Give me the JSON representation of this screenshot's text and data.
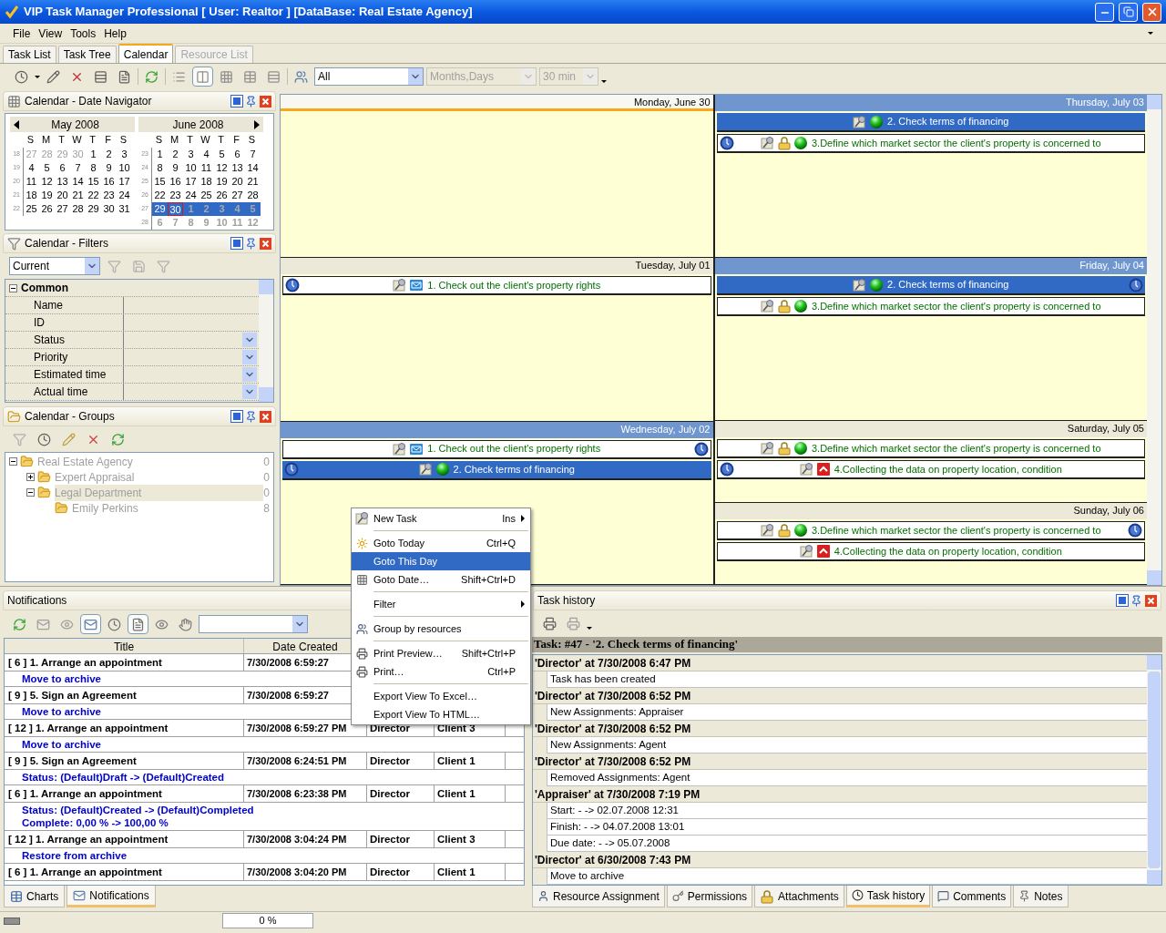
{
  "window": {
    "title": "VIP Task Manager Professional [ User: Realtor ] [DataBase: Real Estate Agency]"
  },
  "menu": [
    "File",
    "View",
    "Tools",
    "Help"
  ],
  "tabs": [
    {
      "label": "Task List",
      "selected": false,
      "disabled": false
    },
    {
      "label": "Task Tree",
      "selected": false,
      "disabled": false
    },
    {
      "label": "Calendar",
      "selected": true,
      "disabled": false
    },
    {
      "label": "Resource List",
      "selected": false,
      "disabled": true
    }
  ],
  "toolbar": {
    "views": [
      {
        "selected": false
      },
      {
        "selected": true
      },
      {
        "selected": false
      },
      {
        "selected": false
      },
      {
        "selected": false
      }
    ],
    "combos": [
      {
        "value": "All",
        "disabled": false
      },
      {
        "value": "Months,Days",
        "disabled": true
      },
      {
        "value": "30 min",
        "disabled": true
      }
    ]
  },
  "date_navigator": {
    "title": "Calendar - Date Navigator",
    "months": [
      {
        "title": "May 2008",
        "weekdays": [
          "S",
          "M",
          "T",
          "W",
          "T",
          "F",
          "S"
        ],
        "weeks": [
          {
            "number": "18",
            "days": [
              {
                "label": "27",
                "other": true,
                "selected": false,
                "today": false
              },
              {
                "label": "28",
                "other": true,
                "selected": false,
                "today": false
              },
              {
                "label": "29",
                "other": true,
                "selected": false,
                "today": false
              },
              {
                "label": "30",
                "other": true,
                "selected": false,
                "today": false
              },
              {
                "label": "1",
                "other": false,
                "selected": false,
                "today": false
              },
              {
                "label": "2",
                "other": false,
                "selected": false,
                "today": false
              },
              {
                "label": "3",
                "other": false,
                "selected": false,
                "today": false
              }
            ]
          },
          {
            "number": "19",
            "days": [
              {
                "label": "4",
                "other": false,
                "selected": false,
                "today": false
              },
              {
                "label": "5",
                "other": false,
                "selected": false,
                "today": false
              },
              {
                "label": "6",
                "other": false,
                "selected": false,
                "today": false
              },
              {
                "label": "7",
                "other": false,
                "selected": false,
                "today": false
              },
              {
                "label": "8",
                "other": false,
                "selected": false,
                "today": false
              },
              {
                "label": "9",
                "other": false,
                "selected": false,
                "today": false
              },
              {
                "label": "10",
                "other": false,
                "selected": false,
                "today": false
              }
            ]
          },
          {
            "number": "20",
            "days": [
              {
                "label": "11",
                "other": false,
                "selected": false,
                "today": false
              },
              {
                "label": "12",
                "other": false,
                "selected": false,
                "today": false
              },
              {
                "label": "13",
                "other": false,
                "selected": false,
                "today": false
              },
              {
                "label": "14",
                "other": false,
                "selected": false,
                "today": false
              },
              {
                "label": "15",
                "other": false,
                "selected": false,
                "today": false
              },
              {
                "label": "16",
                "other": false,
                "selected": false,
                "today": false
              },
              {
                "label": "17",
                "other": false,
                "selected": false,
                "today": false
              }
            ]
          },
          {
            "number": "21",
            "days": [
              {
                "label": "18",
                "other": false,
                "selected": false,
                "today": false
              },
              {
                "label": "19",
                "other": false,
                "selected": false,
                "today": false
              },
              {
                "label": "20",
                "other": false,
                "selected": false,
                "today": false
              },
              {
                "label": "21",
                "other": false,
                "selected": false,
                "today": false
              },
              {
                "label": "22",
                "other": false,
                "selected": false,
                "today": false
              },
              {
                "label": "23",
                "other": false,
                "selected": false,
                "today": false
              },
              {
                "label": "24",
                "other": false,
                "selected": false,
                "today": false
              }
            ]
          },
          {
            "number": "22",
            "days": [
              {
                "label": "25",
                "other": false,
                "selected": false,
                "today": false
              },
              {
                "label": "26",
                "other": false,
                "selected": false,
                "today": false
              },
              {
                "label": "27",
                "other": false,
                "selected": false,
                "today": false
              },
              {
                "label": "28",
                "other": false,
                "selected": false,
                "today": false
              },
              {
                "label": "29",
                "other": false,
                "selected": false,
                "today": false
              },
              {
                "label": "30",
                "other": false,
                "selected": false,
                "today": false
              },
              {
                "label": "31",
                "other": false,
                "selected": false,
                "today": false
              }
            ]
          }
        ]
      },
      {
        "title": "June 2008",
        "weekdays": [
          "S",
          "M",
          "T",
          "W",
          "T",
          "F",
          "S"
        ],
        "weeks": [
          {
            "number": "23",
            "days": [
              {
                "label": "1",
                "other": false,
                "selected": false,
                "today": false
              },
              {
                "label": "2",
                "other": false,
                "selected": false,
                "today": false
              },
              {
                "label": "3",
                "other": false,
                "selected": false,
                "today": false
              },
              {
                "label": "4",
                "other": false,
                "selected": false,
                "today": false
              },
              {
                "label": "5",
                "other": false,
                "selected": false,
                "today": false
              },
              {
                "label": "6",
                "other": false,
                "selected": false,
                "today": false
              },
              {
                "label": "7",
                "other": false,
                "selected": false,
                "today": false
              }
            ]
          },
          {
            "number": "24",
            "days": [
              {
                "label": "8",
                "other": false,
                "selected": false,
                "today": false
              },
              {
                "label": "9",
                "other": false,
                "selected": false,
                "today": false
              },
              {
                "label": "10",
                "other": false,
                "selected": false,
                "today": false
              },
              {
                "label": "11",
                "other": false,
                "selected": false,
                "today": false
              },
              {
                "label": "12",
                "other": false,
                "selected": false,
                "today": false
              },
              {
                "label": "13",
                "other": false,
                "selected": false,
                "today": false
              },
              {
                "label": "14",
                "other": false,
                "selected": false,
                "today": false
              }
            ]
          },
          {
            "number": "25",
            "days": [
              {
                "label": "15",
                "other": false,
                "selected": false,
                "today": false
              },
              {
                "label": "16",
                "other": false,
                "selected": false,
                "today": false
              },
              {
                "label": "17",
                "other": false,
                "selected": false,
                "today": false
              },
              {
                "label": "18",
                "other": false,
                "selected": false,
                "today": false
              },
              {
                "label": "19",
                "other": false,
                "selected": false,
                "today": false
              },
              {
                "label": "20",
                "other": false,
                "selected": false,
                "today": false
              },
              {
                "label": "21",
                "other": false,
                "selected": false,
                "today": false
              }
            ]
          },
          {
            "number": "26",
            "days": [
              {
                "label": "22",
                "other": false,
                "selected": false,
                "today": false
              },
              {
                "label": "23",
                "other": false,
                "selected": false,
                "today": false
              },
              {
                "label": "24",
                "other": false,
                "selected": false,
                "today": false
              },
              {
                "label": "25",
                "other": false,
                "selected": false,
                "today": false
              },
              {
                "label": "26",
                "other": false,
                "selected": false,
                "today": false
              },
              {
                "label": "27",
                "other": false,
                "selected": false,
                "today": false
              },
              {
                "label": "28",
                "other": false,
                "selected": false,
                "today": false
              }
            ]
          },
          {
            "number": "27",
            "days": [
              {
                "label": "29",
                "other": false,
                "selected": true,
                "today": false
              },
              {
                "label": "30",
                "other": false,
                "selected": true,
                "today": true
              },
              {
                "label": "1",
                "other": true,
                "selected": true,
                "today": false
              },
              {
                "label": "2",
                "other": true,
                "selected": true,
                "today": false
              },
              {
                "label": "3",
                "other": true,
                "selected": true,
                "today": false
              },
              {
                "label": "4",
                "other": true,
                "selected": true,
                "today": false
              },
              {
                "label": "5",
                "other": true,
                "selected": true,
                "today": false
              }
            ]
          },
          {
            "number": "28",
            "days": [
              {
                "label": "6",
                "other": true,
                "selected": false,
                "today": false
              },
              {
                "label": "7",
                "other": true,
                "selected": false,
                "today": false
              },
              {
                "label": "8",
                "other": true,
                "selected": false,
                "today": false
              },
              {
                "label": "9",
                "other": true,
                "selected": false,
                "today": false
              },
              {
                "label": "10",
                "other": true,
                "selected": false,
                "today": false
              },
              {
                "label": "11",
                "other": true,
                "selected": false,
                "today": false
              },
              {
                "label": "12",
                "other": true,
                "selected": false,
                "today": false
              }
            ]
          }
        ]
      }
    ]
  },
  "filters": {
    "title": "Calendar - Filters",
    "combo": "Current",
    "category": {
      "label": "Common",
      "expanded": true
    },
    "rows": [
      {
        "label": "Name",
        "kind": "text"
      },
      {
        "label": "ID",
        "kind": "text"
      },
      {
        "label": "Status",
        "kind": "dropdown"
      },
      {
        "label": "Priority",
        "kind": "dropdown"
      },
      {
        "label": "Estimated time",
        "kind": "dropdown"
      },
      {
        "label": "Actual time",
        "kind": "dropdown"
      }
    ]
  },
  "groups": {
    "title": "Calendar - Groups",
    "tree": [
      {
        "label": "Real Estate Agency",
        "count": "0",
        "expanded": true,
        "selected": false,
        "children": [
          {
            "label": "Expert Appraisal",
            "count": "0",
            "expanded": false,
            "selected": false
          },
          {
            "label": "Legal Department",
            "count": "0",
            "expanded": true,
            "selected": true,
            "children": [
              {
                "label": "Emily Perkins",
                "count": "8",
                "selected": false
              }
            ]
          }
        ]
      }
    ]
  },
  "calendar": {
    "columns": [
      [
        {
          "label": "Monday, June 30",
          "selected": false,
          "today": true
        },
        {
          "label": "Tuesday, July 01",
          "selected": false,
          "today": false,
          "events": [
            {
              "title": "1. Check out the client's property rights",
              "selected": false,
              "icons": [
                {
                  "kind": "task"
                },
                {
                  "kind": "mail"
                }
              ],
              "clock_left": true,
              "clock_right": false
            }
          ]
        },
        {
          "label": "Wednesday, July 02",
          "selected": true,
          "today": false,
          "events": [
            {
              "title": "1. Check out the client's property rights",
              "selected": false,
              "icons": [
                {
                  "kind": "task"
                },
                {
                  "kind": "mail"
                }
              ],
              "clock_left": false,
              "clock_right": true
            },
            {
              "title": "2. Check terms of financing",
              "selected": true,
              "icons": [
                {
                  "kind": "task"
                },
                {
                  "kind": "green"
                }
              ],
              "clock_left": true,
              "clock_right": false
            }
          ]
        }
      ],
      [
        {
          "label": "Thursday, July 03",
          "selected": true,
          "today": false,
          "events": [
            {
              "title": "2. Check terms of financing",
              "selected": true,
              "icons": [
                {
                  "kind": "task"
                },
                {
                  "kind": "green"
                }
              ],
              "clock_left": false,
              "clock_right": false
            },
            {
              "title": "3.Define which market sector the client's property is concerned to",
              "selected": false,
              "icons": [
                {
                  "kind": "task"
                },
                {
                  "kind": "lock"
                },
                {
                  "kind": "green"
                }
              ],
              "clock_left": true,
              "clock_right": false
            }
          ]
        },
        {
          "label": "Friday, July 04",
          "selected": true,
          "today": false,
          "events": [
            {
              "title": "2. Check terms of financing",
              "selected": true,
              "icons": [
                {
                  "kind": "task"
                },
                {
                  "kind": "green"
                }
              ],
              "clock_left": false,
              "clock_right": true
            },
            {
              "title": "3.Define which market sector the client's property is concerned to",
              "selected": false,
              "icons": [
                {
                  "kind": "task"
                },
                {
                  "kind": "lock"
                },
                {
                  "kind": "green"
                }
              ],
              "clock_left": false,
              "clock_right": false
            }
          ]
        },
        {
          "label": "Saturday, July 05",
          "selected": false,
          "today": false,
          "events": [
            {
              "title": "3.Define which market sector the client's property is concerned to",
              "selected": false,
              "icons": [
                {
                  "kind": "task"
                },
                {
                  "kind": "lock"
                },
                {
                  "kind": "green"
                }
              ],
              "clock_left": false,
              "clock_right": false
            },
            {
              "title": "4.Collecting the data on property location, condition",
              "selected": false,
              "icons": [
                {
                  "kind": "task"
                },
                {
                  "kind": "red"
                }
              ],
              "clock_left": true,
              "clock_right": false
            }
          ]
        },
        {
          "label": "Sunday, July 06",
          "selected": false,
          "today": false,
          "events": [
            {
              "title": "3.Define which market sector the client's property is concerned to",
              "selected": false,
              "icons": [
                {
                  "kind": "task"
                },
                {
                  "kind": "lock"
                },
                {
                  "kind": "green"
                }
              ],
              "clock_left": false,
              "clock_right": true
            },
            {
              "title": "4.Collecting the data on property location, condition",
              "selected": false,
              "icons": [
                {
                  "kind": "task"
                },
                {
                  "kind": "red"
                }
              ],
              "clock_left": false,
              "clock_right": false
            }
          ]
        }
      ]
    ]
  },
  "context_menu": [
    {
      "kind": "item",
      "label": "New Task",
      "shortcut": "Ins",
      "submenu": true,
      "selected": false
    },
    {
      "kind": "separator"
    },
    {
      "kind": "item",
      "label": "Goto Today",
      "shortcut": "Ctrl+Q",
      "submenu": false,
      "selected": false
    },
    {
      "kind": "item",
      "label": "Goto This Day",
      "submenu": false,
      "selected": true
    },
    {
      "kind": "item",
      "label": "Goto Date…",
      "shortcut": "Shift+Ctrl+D",
      "submenu": false,
      "selected": false
    },
    {
      "kind": "separator"
    },
    {
      "kind": "item",
      "label": "Filter",
      "submenu": true,
      "selected": false
    },
    {
      "kind": "separator"
    },
    {
      "kind": "item",
      "label": "Group by resources",
      "submenu": false,
      "selected": false
    },
    {
      "kind": "separator"
    },
    {
      "kind": "item",
      "label": "Print Preview…",
      "shortcut": "Shift+Ctrl+P",
      "submenu": false,
      "selected": false
    },
    {
      "kind": "item",
      "label": "Print…",
      "shortcut": "Ctrl+P",
      "submenu": false,
      "selected": false
    },
    {
      "kind": "separator"
    },
    {
      "kind": "item",
      "label": "Export View To Excel…",
      "submenu": false,
      "selected": false
    },
    {
      "kind": "item",
      "label": "Export View To HTML…",
      "submenu": false,
      "selected": false
    }
  ],
  "notifications": {
    "title": "Notifications",
    "columns": [
      "Title",
      "Date Created"
    ],
    "rows": [
      {
        "title": "[ 6 ] 1. Arrange an appointment",
        "date": "7/30/2008 6:59:27",
        "details": [
          "Move to archive"
        ]
      },
      {
        "title": "[ 9 ] 5. Sign an Agreement",
        "date": "7/30/2008 6:59:27",
        "details": [
          "Move to archive"
        ]
      },
      {
        "title": "[ 12 ] 1. Arrange an appointment",
        "date": "7/30/2008 6:59:27 PM",
        "author": "Director",
        "client": "Client 3",
        "details": [
          "Move to archive"
        ]
      },
      {
        "title": "[ 9 ] 5. Sign an Agreement",
        "date": "7/30/2008 6:24:51 PM",
        "author": "Director",
        "client": "Client 1",
        "details": [
          "Status: (Default)Draft -> (Default)Created"
        ]
      },
      {
        "title": "[ 6 ] 1. Arrange an appointment",
        "date": "7/30/2008 6:23:38 PM",
        "author": "Director",
        "client": "Client 1",
        "details": [
          "Status: (Default)Created -> (Default)Completed",
          "Complete: 0,00 % -> 100,00 %"
        ]
      },
      {
        "title": "[ 12 ] 1. Arrange an appointment",
        "date": "7/30/2008 3:04:24 PM",
        "author": "Director",
        "client": "Client 3",
        "details": [
          "Restore from archive"
        ]
      },
      {
        "title": "[ 6 ] 1. Arrange an appointment",
        "date": "7/30/2008 3:04:20 PM",
        "author": "Director",
        "client": "Client 1",
        "details": []
      }
    ],
    "tabs": [
      {
        "label": "Charts",
        "selected": false
      },
      {
        "label": "Notifications",
        "selected": true
      }
    ]
  },
  "task_history": {
    "title": "Task history",
    "header": "Task: #47 - '2. Check terms of financing'",
    "entries": [
      {
        "heading": "'Director' at 7/30/2008 6:47 PM",
        "lines": [
          "Task has been created"
        ]
      },
      {
        "heading": "'Director' at 7/30/2008 6:52 PM",
        "lines": [
          "New Assignments: Appraiser"
        ]
      },
      {
        "heading": "'Director' at 7/30/2008 6:52 PM",
        "lines": [
          "New Assignments: Agent"
        ]
      },
      {
        "heading": "'Director' at 7/30/2008 6:52 PM",
        "lines": [
          "Removed Assignments: Agent"
        ]
      },
      {
        "heading": "'Appraiser' at 7/30/2008 7:19 PM",
        "lines": [
          "Start: - -> 02.07.2008 12:31",
          "Finish: - -> 04.07.2008 13:01",
          "Due date: - -> 05.07.2008"
        ]
      },
      {
        "heading": "'Director' at 6/30/2008 7:43 PM",
        "lines": [
          "Move to archive"
        ]
      }
    ],
    "tabs": [
      {
        "label": "Resource Assignment",
        "selected": false
      },
      {
        "label": "Permissions",
        "selected": false
      },
      {
        "label": "Attachments",
        "selected": false
      },
      {
        "label": "Task history",
        "selected": true
      },
      {
        "label": "Comments",
        "selected": false
      },
      {
        "label": "Notes",
        "selected": false
      }
    ]
  },
  "status_bar": {
    "progress": {
      "label": "0 %",
      "level": 0
    }
  }
}
